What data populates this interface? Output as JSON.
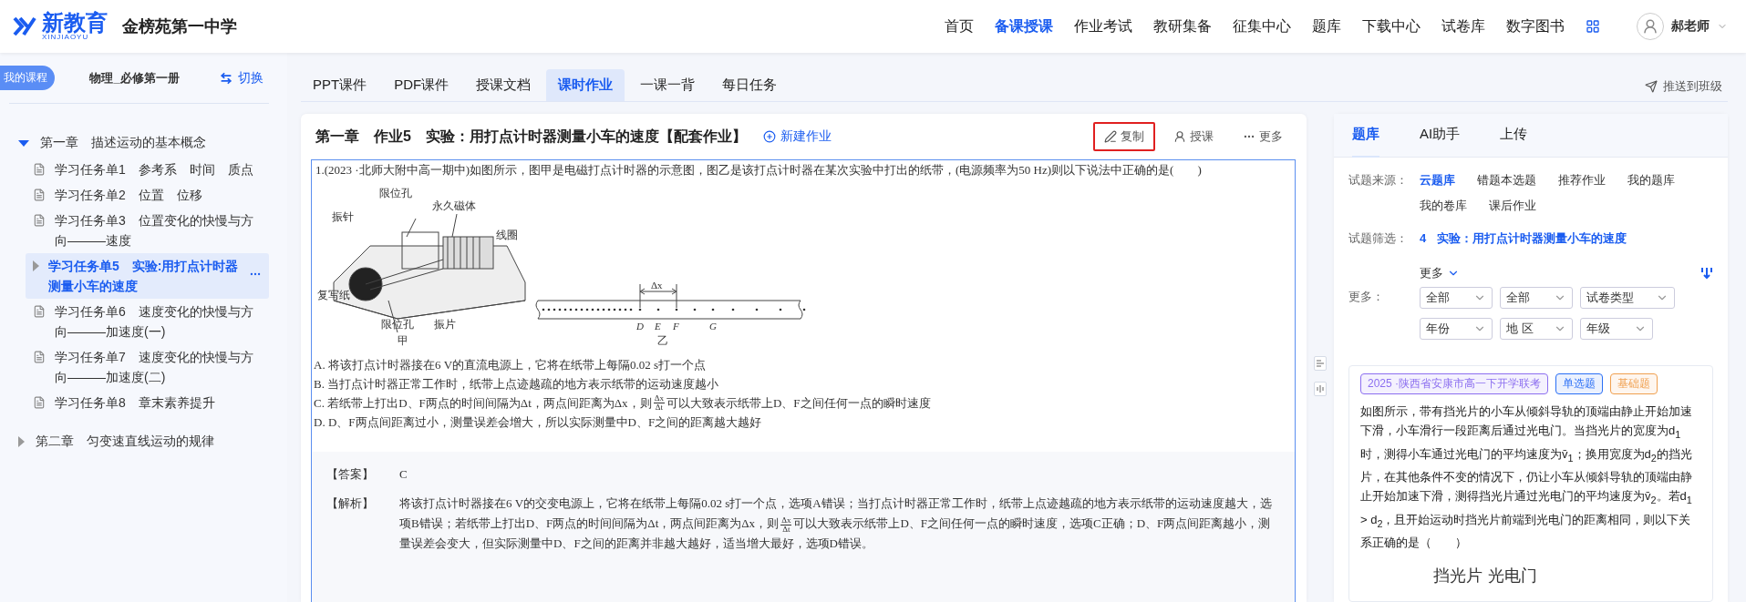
{
  "header": {
    "brand": "新教育",
    "brand_sub": "XINJIAOYU",
    "school": "金榜苑第一中学",
    "nav": [
      {
        "label": "首页",
        "selected": false
      },
      {
        "label": "备课授课",
        "selected": true
      },
      {
        "label": "作业考试",
        "selected": false
      },
      {
        "label": "教研集备",
        "selected": false
      },
      {
        "label": "征集中心",
        "selected": false
      },
      {
        "label": "题库",
        "selected": false
      },
      {
        "label": "下载中心",
        "selected": false
      },
      {
        "label": "试卷库",
        "selected": false
      },
      {
        "label": "数字图书",
        "selected": false
      }
    ],
    "user": "郝老师"
  },
  "sidebar": {
    "badge": "我的课程",
    "course": "物理_必修第一册",
    "switch": "切换",
    "chapters": [
      {
        "label": "第一章　描述运动的基本概念",
        "expanded": true,
        "children": [
          {
            "label": "学习任务单1　参考系　时间　质点",
            "selected": false
          },
          {
            "label": "学习任务单2　位置　位移",
            "selected": false
          },
          {
            "label": "学习任务单3　位置变化的快慢与方向———速度",
            "selected": false
          },
          {
            "label": "学习任务单5　实验:用打点计时器测量小车的速度",
            "selected": true
          },
          {
            "label": "学习任务单6　速度变化的快慢与方向———加速度(一)",
            "selected": false
          },
          {
            "label": "学习任务单7　速度变化的快慢与方向———加速度(二)",
            "selected": false
          },
          {
            "label": "学习任务单8　章末素养提升",
            "selected": false
          }
        ]
      },
      {
        "label": "第二章　匀变速直线运动的规律",
        "expanded": false
      }
    ]
  },
  "tabs": [
    {
      "label": "PPT课件",
      "selected": false
    },
    {
      "label": "PDF课件",
      "selected": false
    },
    {
      "label": "授课文档",
      "selected": false
    },
    {
      "label": "课时作业",
      "selected": true
    },
    {
      "label": "一课一背",
      "selected": false
    },
    {
      "label": "每日任务",
      "selected": false
    }
  ],
  "push": "推送到班级",
  "assignment": {
    "title": "第一章　作业5　实验：用打点计时器测量小车的速度【配套作业】",
    "new": "新建作业",
    "actions": [
      {
        "kind": "copy",
        "label": "复制",
        "highlighted": true
      },
      {
        "kind": "teach",
        "label": "授课",
        "highlighted": false
      },
      {
        "kind": "more",
        "label": "更多",
        "highlighted": false
      }
    ],
    "question": {
      "stem": "1.(2023 ·北师大附中高一期中)如图所示，图甲是电磁打点计时器的示意图，图乙是该打点计时器在某次实验中打出的纸带，(电源频率为50 Hz)则以下说法中正确的是(　　)",
      "figure_1": {
        "labels": [
          "限位孔",
          "永久磁体",
          "振针",
          "线圈",
          "复写纸",
          "限位孔",
          "振片"
        ],
        "caption": "甲"
      },
      "figure_2": {
        "labels": [
          "D",
          "E",
          "F",
          "G"
        ],
        "span": "Δx",
        "caption": "乙"
      },
      "options": [
        [
          {
            "kind": "text",
            "text": "A. 将该打点计时器接在6 V的直流电源上，它将在纸带上每隔0.02 s打一个点"
          }
        ],
        [
          {
            "kind": "text",
            "text": "B. 当打点计时器正常工作时，纸带上点迹越疏的地方表示纸带的运动速度越小"
          }
        ],
        [
          {
            "kind": "text",
            "text": "C. 若纸带上打出D、F两点的时间间隔为Δt，两点间距离为Δx，则"
          },
          {
            "kind": "frac",
            "num": "Δx",
            "den": "Δt"
          },
          {
            "kind": "text",
            "text": "可以大致表示纸带上D、F之间任何一点的瞬时速度"
          }
        ],
        [
          {
            "kind": "text",
            "text": "D. D、F两点间距离过小，测量误差会增大，所以实际测量中D、F之间的距离越大越好"
          }
        ]
      ],
      "answer_label": "【答案】",
      "answer": "C",
      "analysis_label": "【解析】",
      "analysis": [
        {
          "kind": "text",
          "text": "将该打点计时器接在6 V的交变电源上，它将在纸带上每隔0.02 s打一个点，选项A错误；当打点计时器正常工作时，纸带上点迹越疏的地方表示纸带的运动速度越大，选项B错误；若纸带上打出D、F两点的时间间隔为Δt，两点间距离为Δx，则"
        },
        {
          "kind": "frac",
          "num": "Δx",
          "den": "Δt"
        },
        {
          "kind": "text",
          "text": "可以大致表示纸带上D、F之间任何一点的瞬时速度，选项C正确；D、F两点间距离越小，测量误差会变大，但实际测量中D、F之间的距离并非越大越好，适当增大最好，选项D错误。"
        }
      ]
    }
  },
  "panel": {
    "tabs": [
      {
        "label": "题库",
        "selected": true
      },
      {
        "label": "AI助手",
        "selected": false
      },
      {
        "label": "上传",
        "selected": false
      }
    ],
    "source_label": "试题来源：",
    "sources": [
      {
        "label": "云题库",
        "selected": true
      },
      {
        "label": "错题本选题",
        "selected": false
      },
      {
        "label": "推荐作业",
        "selected": false
      },
      {
        "label": "我的题库",
        "selected": false
      },
      {
        "label": "我的卷库",
        "selected": false
      },
      {
        "label": "课后作业",
        "selected": false
      }
    ],
    "filter_label": "试题筛选：",
    "filter_index": "4",
    "filter_value": "实验：用打点计时器测量小车的速度",
    "more_toggle": "更多",
    "more_label": "更多：",
    "selects": [
      "全部",
      "全部",
      "试卷类型",
      "年份",
      "地 区",
      "年级"
    ],
    "card": {
      "tags": [
        {
          "label": "2025 ·陕西省安康市高一下开学联考",
          "color": "#8c6ff0"
        },
        {
          "label": "单选题",
          "color": "#2a6ff5"
        },
        {
          "label": "基础题",
          "color": "#f0a050"
        }
      ],
      "text": "如图所示，带有挡光片的小车从倾斜导轨的顶端由静止开始加速下滑，小车滑行一段距离后通过光电门。当挡光片的宽度为d$_{1}$时，测得小车通过光电门的平均速度为v̄$_{1}$；换用宽度为d$_{2}$的挡光片，在其他条件不变的情况下，仍让小车从倾斜导轨的顶端由静止开始加速下滑，测得挡光片通过光电门的平均速度为v̄$_{2}$。若d$_{1}$ > d$_{2}$，且开始运动时挡光片前端到光电门的距离相同，则以下关系正确的是（　　）",
      "figure_labels": [
        "挡光片",
        "光电门"
      ]
    }
  }
}
